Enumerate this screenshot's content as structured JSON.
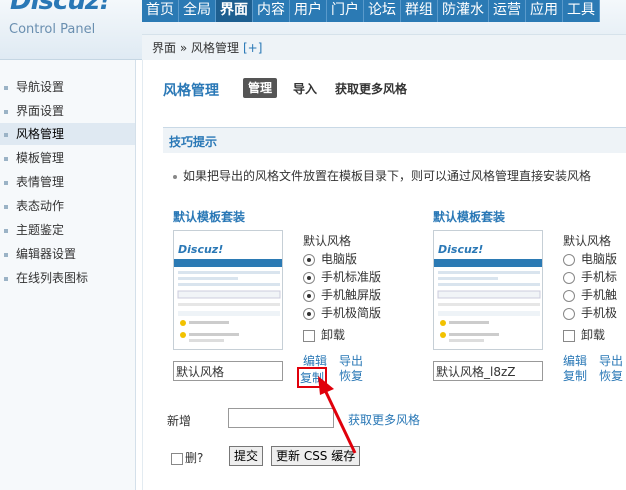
{
  "logo": {
    "name": "Discuz!",
    "subtitle": "Control Panel"
  },
  "topnav": [
    "首页",
    "全局",
    "界面",
    "内容",
    "用户",
    "门户",
    "论坛",
    "群组",
    "防灌水",
    "运营",
    "应用",
    "工具"
  ],
  "active_nav": "界面",
  "breadcrumb": "界面 » 风格管理",
  "breadcrumb_plus": "[+]",
  "sidebar": [
    "导航设置",
    "界面设置",
    "风格管理",
    "模板管理",
    "表情管理",
    "表态动作",
    "主题鉴定",
    "编辑器设置",
    "在线列表图标"
  ],
  "active_sidebar": "风格管理",
  "page": {
    "title": "风格管理",
    "tabs": [
      "管理",
      "导入",
      "获取更多风格"
    ]
  },
  "tips": {
    "title": "技巧提示",
    "text": "如果把导出的风格文件放置在模板目录下，则可以通过风格管理直接安装风格"
  },
  "packs": [
    {
      "title": "默认模板套装",
      "style_label": "默认风格",
      "options": [
        "电脑版",
        "手机标准版",
        "手机触屏版",
        "手机极简版"
      ],
      "selected": [
        true,
        true,
        true,
        true
      ],
      "uninstall": "卸载",
      "name_value": "默认风格",
      "links": {
        "edit": "编辑",
        "export": "导出",
        "copy": "复制",
        "restore": "恢复"
      }
    },
    {
      "title": "默认模板套装",
      "style_label": "默认风格",
      "options": [
        "电脑版",
        "手机标",
        "手机触",
        "手机极"
      ],
      "selected": [
        false,
        false,
        false,
        false
      ],
      "uninstall": "卸载",
      "name_value": "默认风格_l8zZ",
      "links": {
        "edit": "编辑",
        "export": "导出",
        "copy": "复制",
        "restore": "恢复"
      }
    }
  ],
  "new_row": {
    "label": "新增",
    "link": "获取更多风格"
  },
  "del_label": "删?",
  "buttons": {
    "submit": "提交",
    "refresh": "更新 CSS 缓存"
  },
  "thumb_logo": "Discuz!",
  "colors": {
    "accent": "#2a78b6",
    "nav": "#2b7ab4",
    "highlight": "#e0000b"
  }
}
